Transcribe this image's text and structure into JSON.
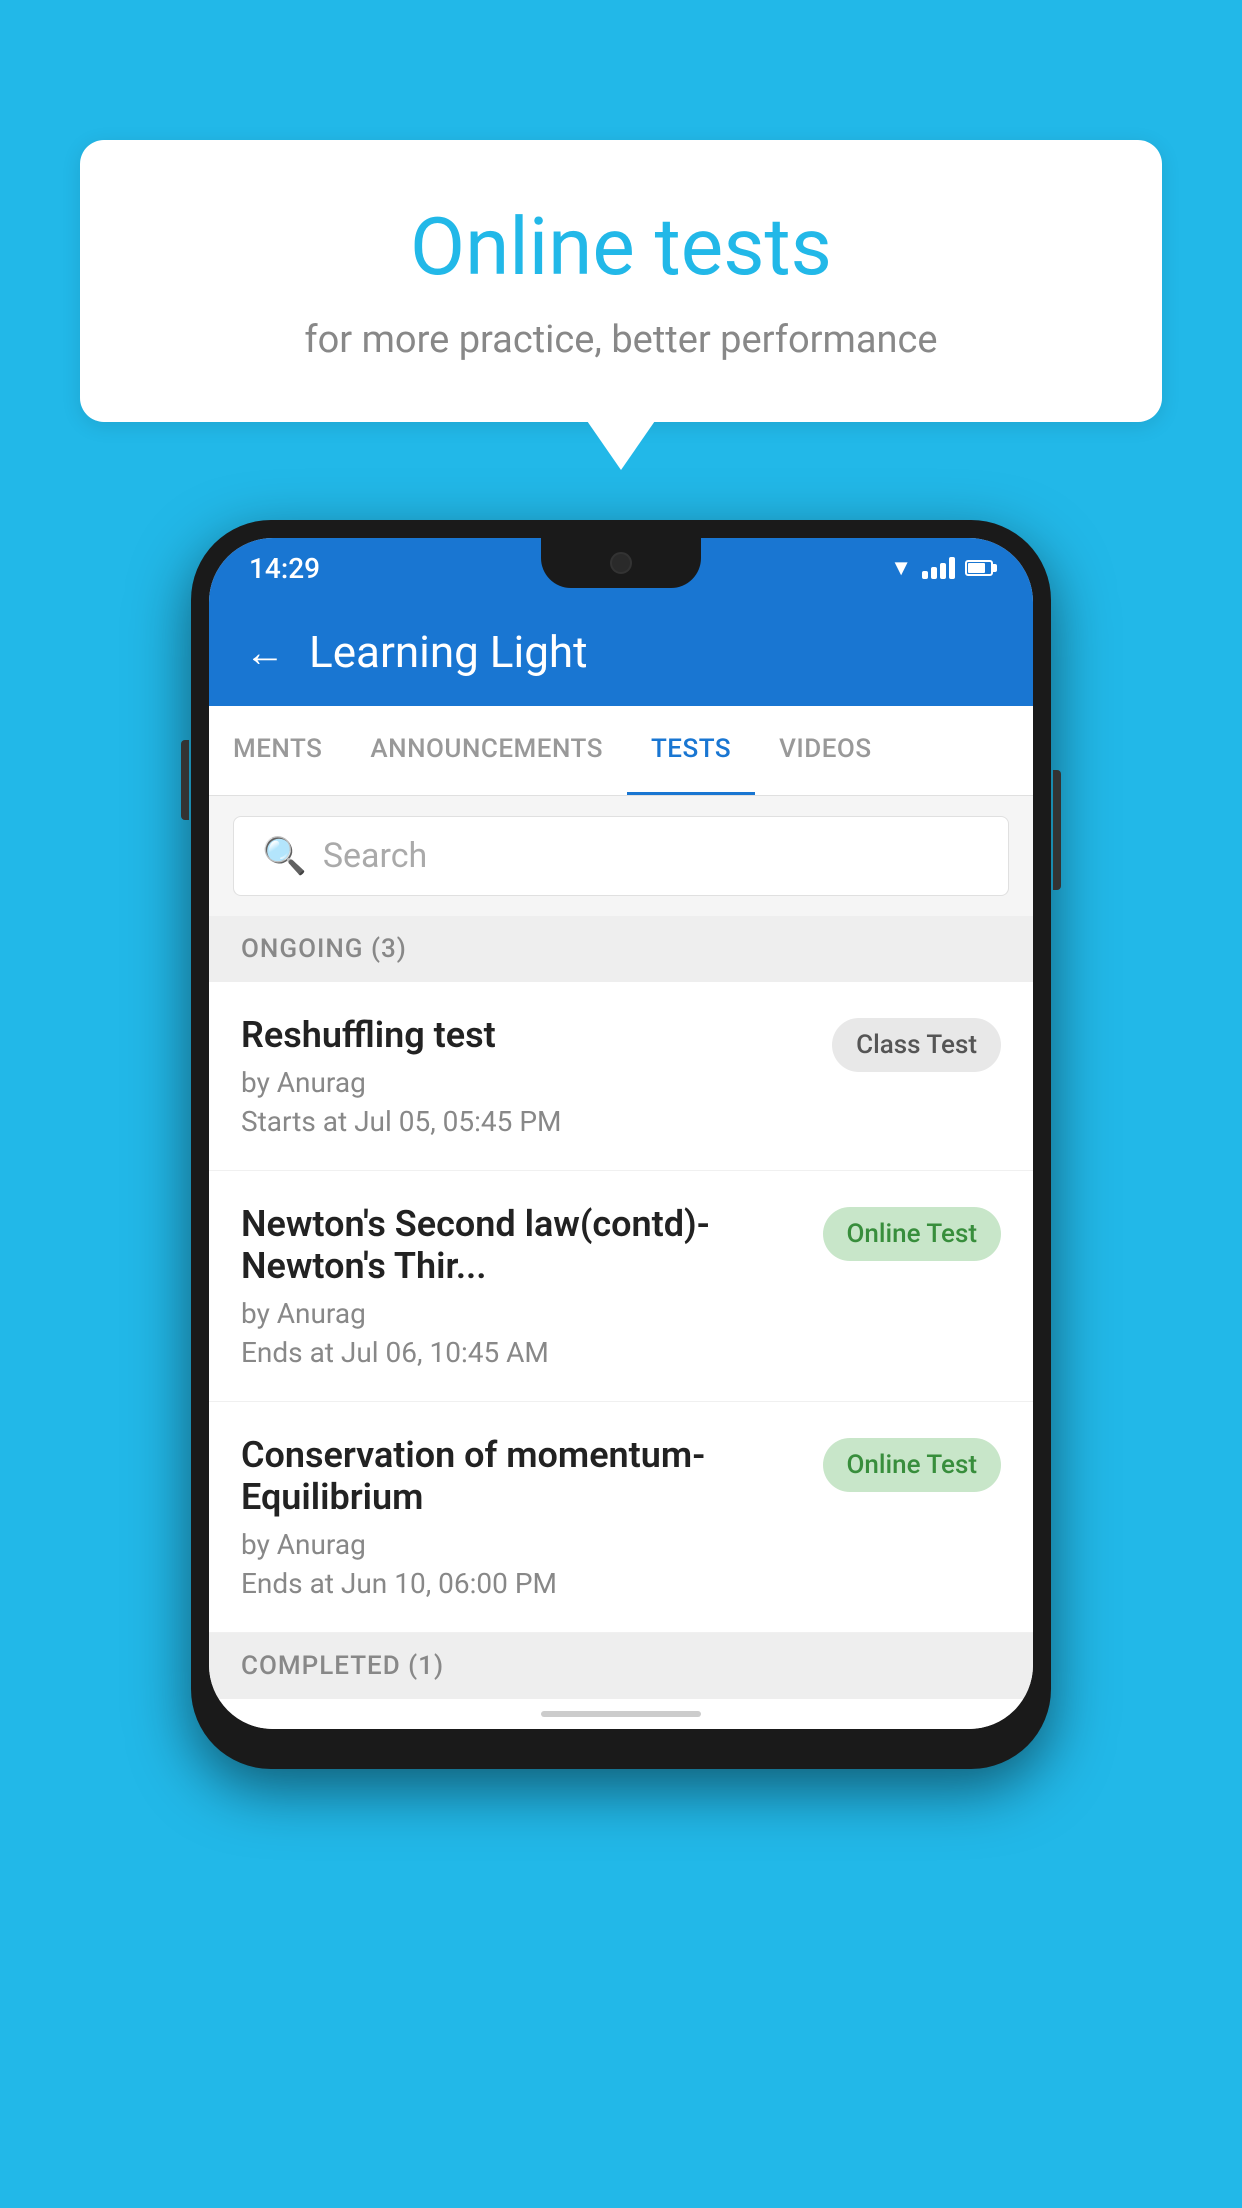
{
  "background_color": "#22b8e8",
  "speech_bubble": {
    "title": "Online tests",
    "subtitle": "for more practice, better performance"
  },
  "status_bar": {
    "time": "14:29",
    "wifi": "▼",
    "battery_percent": 70
  },
  "app_header": {
    "title": "Learning Light",
    "back_label": "←"
  },
  "tabs": [
    {
      "label": "MENTS",
      "active": false
    },
    {
      "label": "ANNOUNCEMENTS",
      "active": false
    },
    {
      "label": "TESTS",
      "active": true
    },
    {
      "label": "VIDEOS",
      "active": false
    }
  ],
  "search": {
    "placeholder": "Search"
  },
  "sections": [
    {
      "title": "ONGOING (3)",
      "items": [
        {
          "title": "Reshuffling test",
          "author": "by Anurag",
          "time_label": "Starts at",
          "time": "Jul 05, 05:45 PM",
          "badge": "Class Test",
          "badge_type": "class"
        },
        {
          "title": "Newton's Second law(contd)-Newton's Thir...",
          "author": "by Anurag",
          "time_label": "Ends at",
          "time": "Jul 06, 10:45 AM",
          "badge": "Online Test",
          "badge_type": "online"
        },
        {
          "title": "Conservation of momentum-Equilibrium",
          "author": "by Anurag",
          "time_label": "Ends at",
          "time": "Jun 10, 06:00 PM",
          "badge": "Online Test",
          "badge_type": "online"
        }
      ]
    }
  ],
  "completed_section": {
    "title": "COMPLETED (1)"
  }
}
